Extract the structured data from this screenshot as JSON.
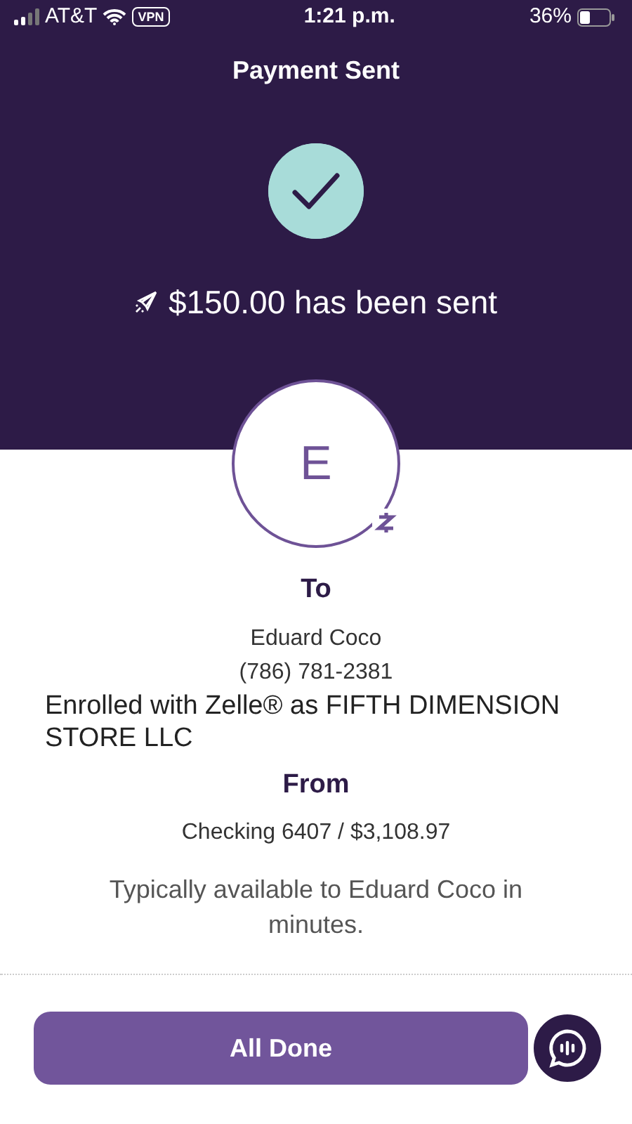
{
  "status_bar": {
    "carrier": "AT&T",
    "vpn": "VPN",
    "time": "1:21 p.m.",
    "battery": "36%"
  },
  "header": {
    "title": "Payment Sent"
  },
  "confirmation": {
    "message": "$150.00 has been sent"
  },
  "recipient": {
    "initial": "E",
    "label": "To",
    "name": "Eduard Coco",
    "phone": "(786) 781-2381",
    "enrollment": "Enrolled with Zelle® as FIFTH DIMENSION STORE LLC"
  },
  "source": {
    "label": "From",
    "account": "Checking 6407 / $3,108.97"
  },
  "availability": "Typically available to Eduard Coco in minutes.",
  "buttons": [
    {
      "label": "All Done"
    }
  ]
}
